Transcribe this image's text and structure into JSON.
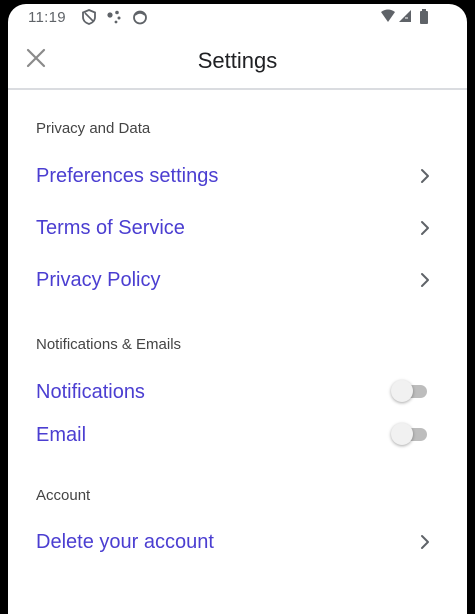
{
  "status_bar": {
    "time": "11:19",
    "icons": [
      "shield-icon",
      "dots-icon",
      "face-icon",
      "wifi-icon",
      "signal-icon",
      "battery-icon"
    ]
  },
  "app_bar": {
    "title": "Settings",
    "close_icon": "close-icon"
  },
  "sections": {
    "privacy": {
      "header": "Privacy and Data",
      "items": [
        {
          "label": "Preferences settings"
        },
        {
          "label": "Terms of Service"
        },
        {
          "label": "Privacy Policy"
        }
      ]
    },
    "notifications": {
      "header": "Notifications & Emails",
      "items": [
        {
          "label": "Notifications",
          "enabled": false
        },
        {
          "label": "Email",
          "enabled": false
        }
      ]
    },
    "account": {
      "header": "Account",
      "items": [
        {
          "label": "Delete your account"
        }
      ]
    }
  },
  "colors": {
    "accent": "#4b3ed1",
    "section_text": "#444444",
    "toggle_off_track": "#bdbdbd",
    "divider": "#dadce0"
  }
}
